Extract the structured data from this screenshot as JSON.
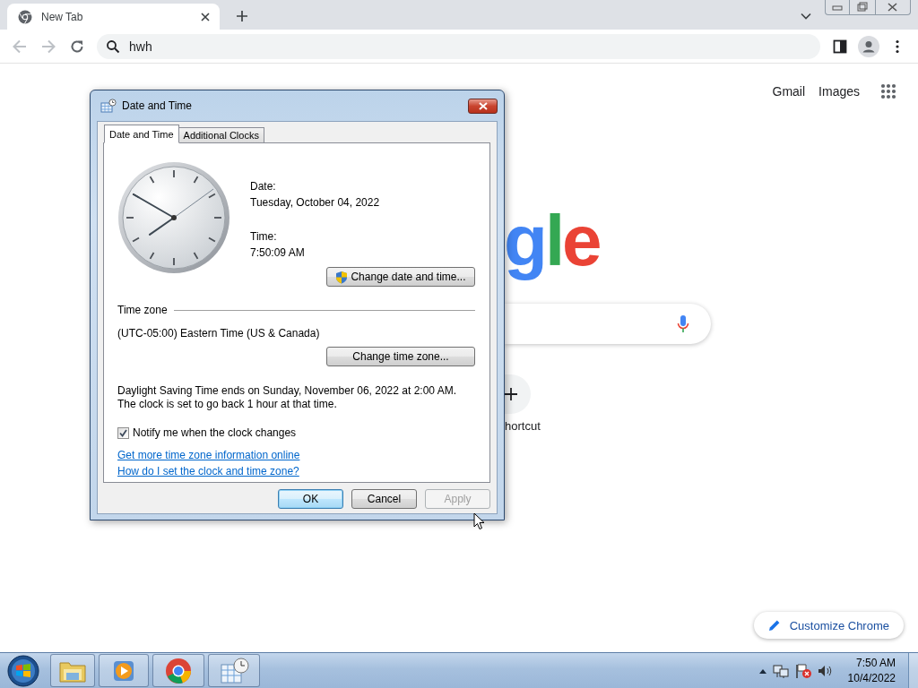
{
  "browser": {
    "tabs": [
      {
        "title": "New Tab",
        "selected": true
      }
    ],
    "back": {
      "disabled": true
    },
    "forward": {
      "disabled": true
    },
    "address": "hwh"
  },
  "page": {
    "header_links": [
      "Gmail",
      "Images"
    ],
    "logo_visible": "gle",
    "shortcut_label": "hortcut",
    "customize_button": "Customize Chrome"
  },
  "dialog": {
    "title": "Date and Time",
    "tabs": [
      {
        "label": "Date and Time",
        "selected": true
      },
      {
        "label": "Additional Clocks",
        "selected": false
      }
    ],
    "date_label": "Date:",
    "date": "Tuesday, October 04, 2022",
    "time_label": "Time:",
    "time": "7:50:09 AM",
    "change_datetime_button": "Change date and time...",
    "timezone_heading": "Time zone",
    "timezone": "(UTC-05:00) Eastern Time (US & Canada)",
    "change_timezone_button": "Change time zone...",
    "dst_note": "Daylight Saving Time ends on Sunday, November 06, 2022 at 2:00 AM. The clock is set to go back 1 hour at that time.",
    "notify": {
      "label": "Notify me when the clock changes",
      "checked": true
    },
    "links": [
      "Get more time zone information online",
      "How do I set the clock and time zone?"
    ],
    "buttons": [
      {
        "label": "OK",
        "default": true,
        "disabled": false
      },
      {
        "label": "Cancel",
        "default": false,
        "disabled": false
      },
      {
        "label": "Apply",
        "default": false,
        "disabled": true
      }
    ]
  },
  "taskbar": {
    "clock_time": "7:50 AM",
    "clock_date": "10/4/2022"
  }
}
